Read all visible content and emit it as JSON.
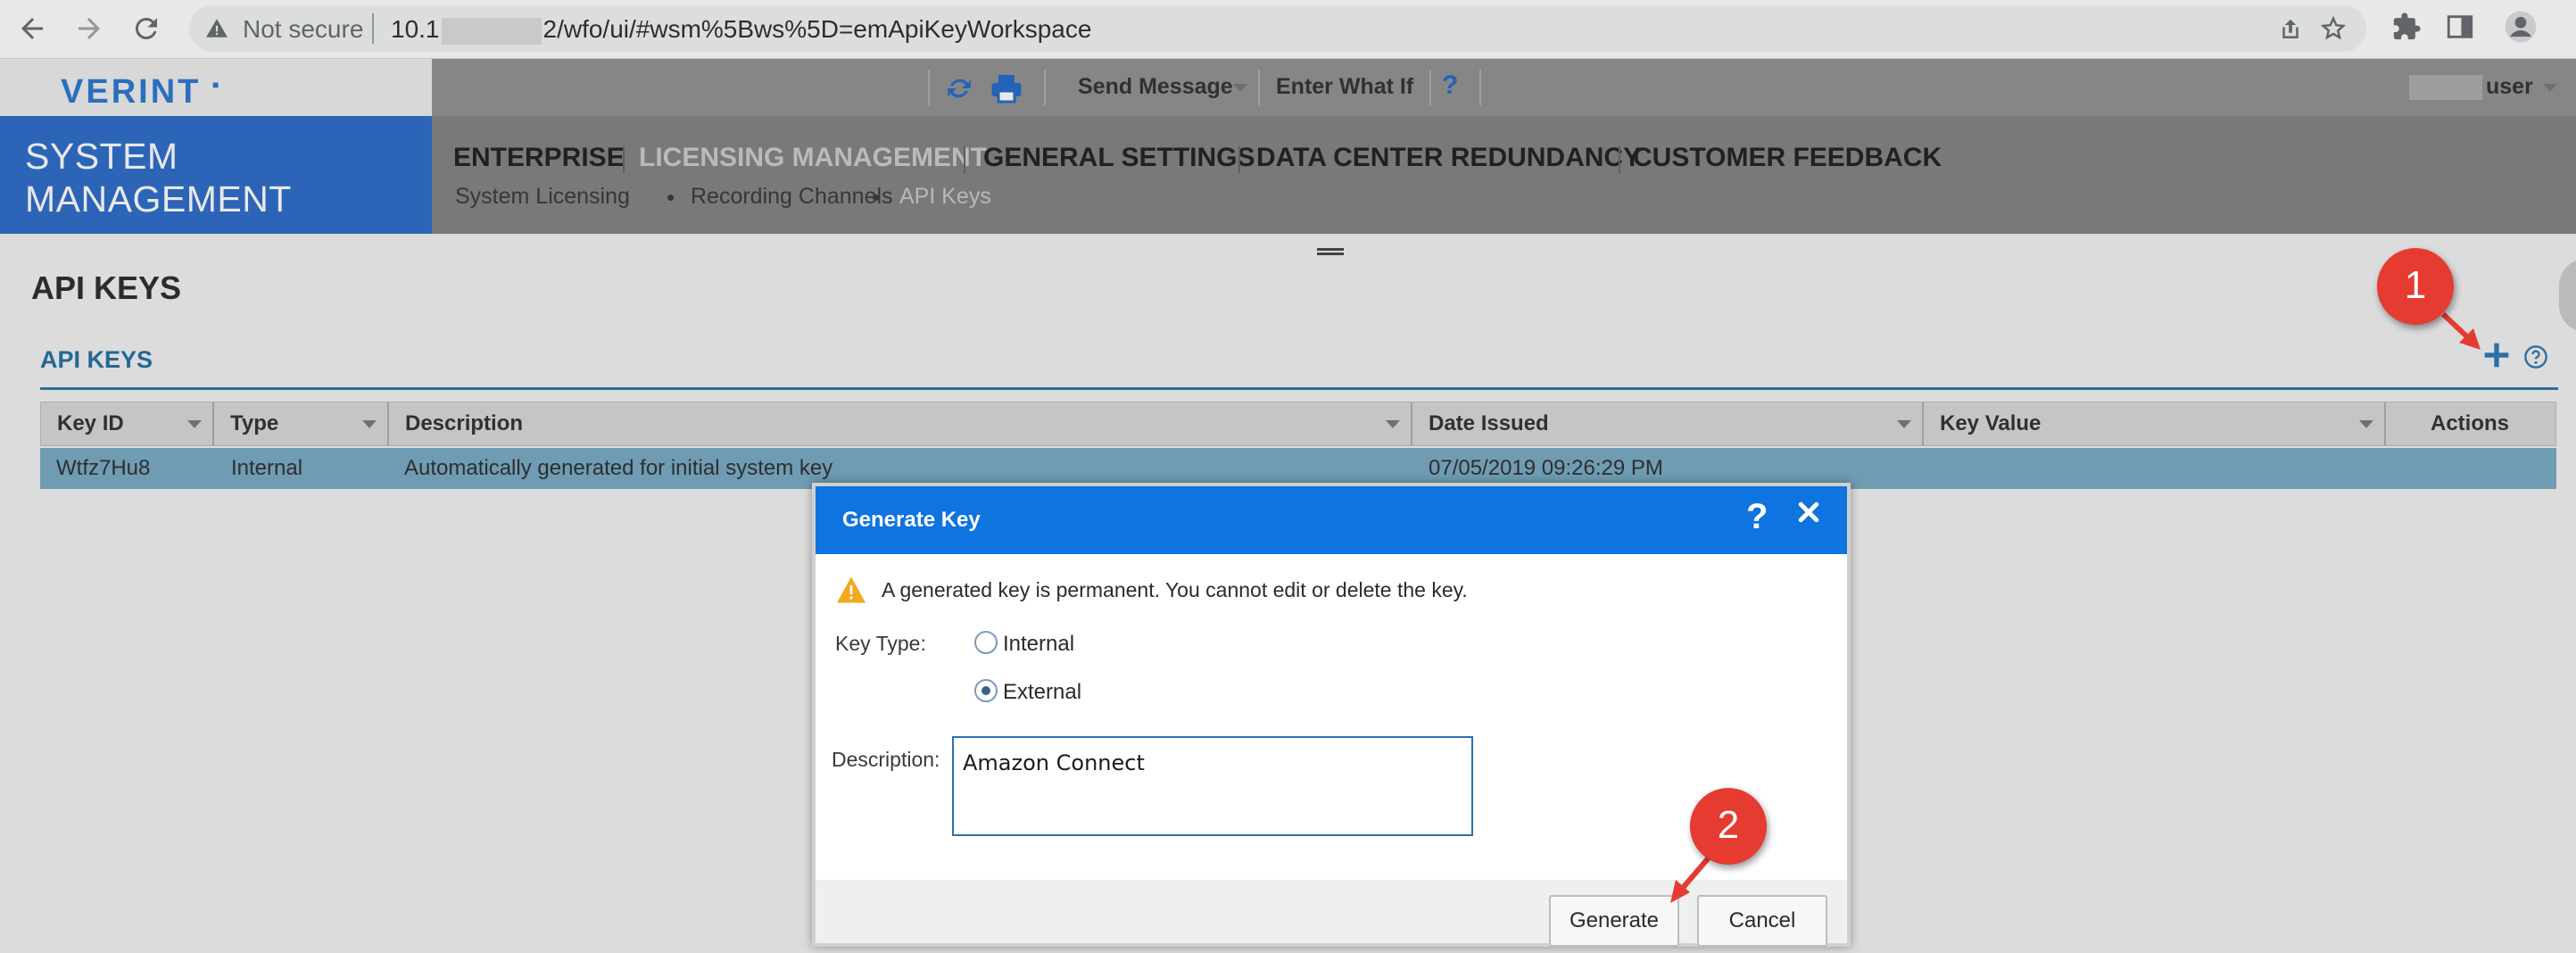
{
  "browser": {
    "security_label": "Not secure",
    "url_prefix": "10.1",
    "url_suffix": "2/wfo/ui/#wsm%5Bws%5D=emApiKeyWorkspace"
  },
  "app": {
    "logo": "VERINT",
    "module_title_line1": "SYSTEM",
    "module_title_line2": "MANAGEMENT"
  },
  "toolbar": {
    "send_message": "Send Message",
    "enter_what_if": "Enter What If",
    "help": "?",
    "user": "user"
  },
  "menu": {
    "items": [
      {
        "label": "ENTERPRISE"
      },
      {
        "label": "LICENSING MANAGEMENT"
      },
      {
        "label": "GENERAL SETTINGS"
      },
      {
        "label": "DATA CENTER REDUNDANCY"
      },
      {
        "label": "CUSTOMER FEEDBACK"
      }
    ],
    "subitems": [
      {
        "label": "System Licensing"
      },
      {
        "label": "Recording Channels"
      },
      {
        "label": "API Keys"
      }
    ]
  },
  "page": {
    "title": "API KEYS",
    "section_title": "API KEYS"
  },
  "grid": {
    "columns": [
      "Key ID",
      "Type",
      "Description",
      "Date Issued",
      "Key Value",
      "Actions"
    ],
    "rows": [
      {
        "key_id": "Wtfz7Hu8",
        "type": "Internal",
        "description": "Automatically generated for initial system key",
        "date_issued": "07/05/2019 09:26:29 PM",
        "key_value": ""
      }
    ]
  },
  "modal": {
    "title": "Generate Key",
    "help": "?",
    "warning": "A generated key is permanent. You cannot edit or delete the key.",
    "key_type_label": "Key Type:",
    "options": [
      "Internal",
      "External"
    ],
    "selected_option": "External",
    "description_label": "Description:",
    "description_value": "Amazon Connect",
    "generate_label": "Generate",
    "cancel_label": "Cancel"
  },
  "annotations": {
    "callout_1": "1",
    "callout_2": "2"
  },
  "colors": {
    "brand_blue": "#1f63c6",
    "modal_header": "#0f73e0",
    "callout_red": "#e53b31",
    "section_blue": "#16669d",
    "selected_row": "#6fa5c0"
  },
  "icons": [
    "back-icon",
    "forward-icon",
    "reload-icon",
    "warning-icon",
    "share-icon",
    "star-icon",
    "extensions-icon",
    "side-panel-icon",
    "profile-icon",
    "refresh-icon",
    "print-icon",
    "add-icon",
    "help-circle-icon",
    "close-icon",
    "chevron-down-icon"
  ]
}
